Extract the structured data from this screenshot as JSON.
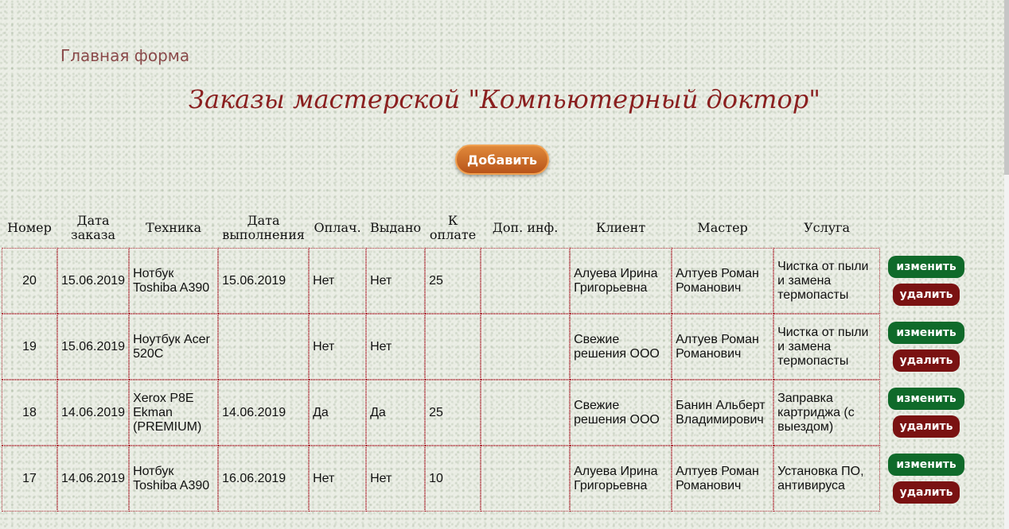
{
  "nav": {
    "home_label": "Главная форма"
  },
  "page": {
    "title": "Заказы мастерской \"Компьютерный доктор\"",
    "add_label": "Добавить"
  },
  "table": {
    "headers": [
      "Номер",
      "Дата заказа",
      "Техника",
      "Дата выполнения",
      "Оплач.",
      "Выдано",
      "К оплате",
      "Доп. инф.",
      "Клиент",
      "Мастер",
      "Услуга"
    ],
    "rows": [
      [
        "20",
        "15.06.2019",
        "Нотбук Toshiba A390",
        "15.06.2019",
        "Нет",
        "Нет",
        "25",
        "",
        "Алуева Ирина Григорьевна",
        "Алтуев Роман Романович",
        "Чистка от пыли и замена термопасты"
      ],
      [
        "19",
        "15.06.2019",
        "Ноутбук Acer 520C",
        "",
        "Нет",
        "Нет",
        "",
        "",
        "Свежие решения ООО",
        "Алтуев Роман Романович",
        "Чистка от пыли и замена термопасты"
      ],
      [
        "18",
        "14.06.2019",
        "Xerox P8E Ekman (PREMIUM)",
        "14.06.2019",
        "Да",
        "Да",
        "25",
        "",
        "Свежие решения ООО",
        "Банин Альберт Владимирович",
        "Заправка картриджа (с выездом)"
      ],
      [
        "17",
        "14.06.2019",
        "Нотбук Toshiba A390",
        "16.06.2019",
        "Нет",
        "Нет",
        "10",
        "",
        "Алуева Ирина Григорьевна",
        "Алтуев Роман Романович",
        "Установка ПО, антивируса"
      ]
    ],
    "edit_label": "изменить",
    "delete_label": "удалить"
  }
}
